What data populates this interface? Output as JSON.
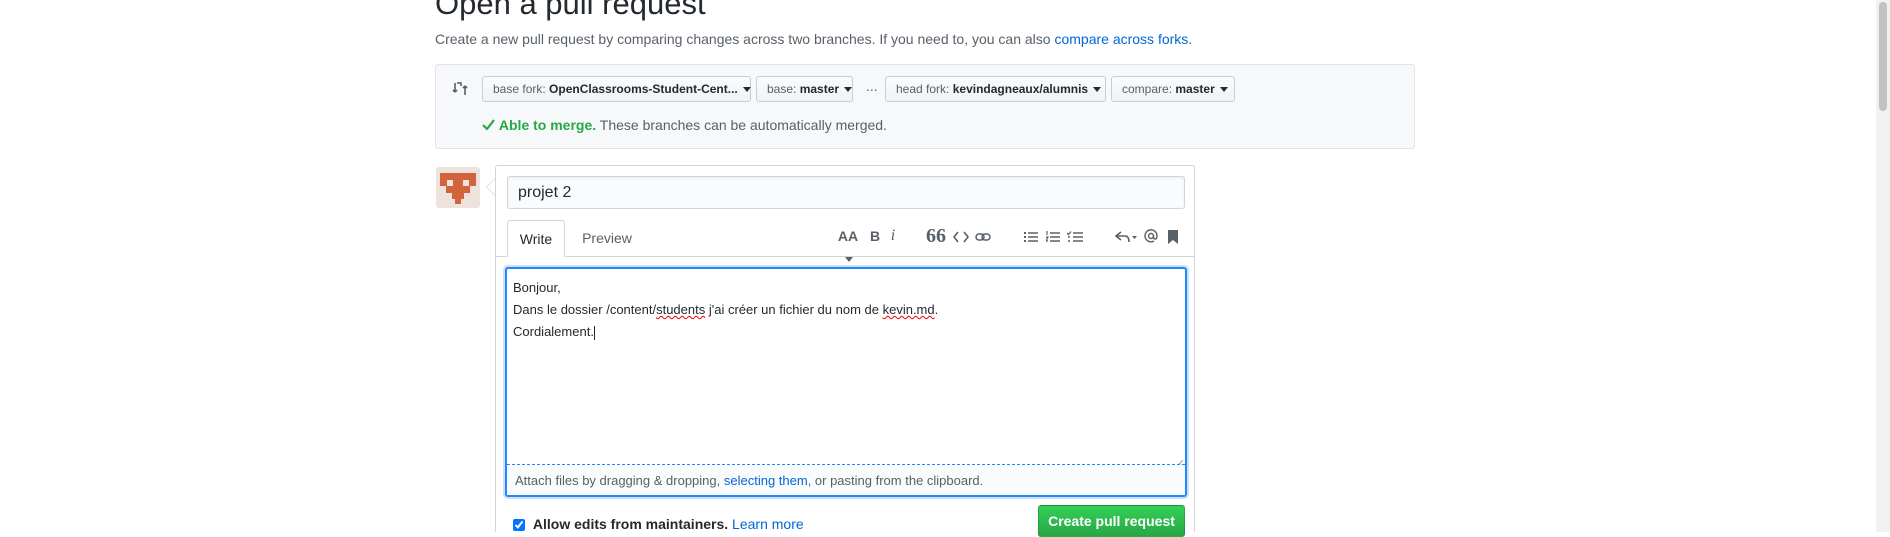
{
  "page": {
    "title": "Open a pull request",
    "subtitle_text": "Create a new pull request by comparing changes across two branches. If you need to, you can also ",
    "subtitle_link": "compare across forks",
    "subtitle_end": "."
  },
  "compare": {
    "base_fork_label": "base fork:",
    "base_fork_value": "OpenClassrooms-Student-Cent...",
    "base_label": "base:",
    "base_value": "master",
    "separator": "...",
    "head_fork_label": "head fork:",
    "head_fork_value": "kevindagneaux/alumnis",
    "compare_label": "compare:",
    "compare_value": "master",
    "merge_status": "Able to merge.",
    "merge_message": "These branches can be automatically merged."
  },
  "form": {
    "title_value": "projet 2",
    "tabs": [
      "Write",
      "Preview"
    ],
    "body_line1": "Bonjour,",
    "body_line2_a": "Dans le dossier /content/",
    "body_line2_b": "students",
    "body_line2_c": " j'ai créer un fichier du nom de ",
    "body_line2_d": "kevin.md",
    "body_line2_e": ".",
    "body_line3": "Cordialement.",
    "attach_text_a": "Attach files by dragging & dropping, ",
    "attach_link": "selecting them",
    "attach_text_b": ", or pasting from the clipboard.",
    "allow_edits_label": "Allow edits from maintainers.",
    "learn_more": "Learn more",
    "allow_edits_checked": true,
    "submit_label": "Create pull request"
  },
  "toolbar": {
    "heading_text": "AA",
    "bold_text": "B",
    "italic_text": "i",
    "quote_text": "66",
    "icons": [
      "header-icon",
      "bold-icon",
      "italic-icon",
      "quote-icon",
      "code-icon",
      "link-icon",
      "unordered-list-icon",
      "ordered-list-icon",
      "task-list-icon",
      "reply-icon",
      "mention-icon",
      "bookmark-icon"
    ]
  },
  "colors": {
    "link": "#0366d6",
    "success": "#28a745",
    "focus": "#2188ff"
  }
}
